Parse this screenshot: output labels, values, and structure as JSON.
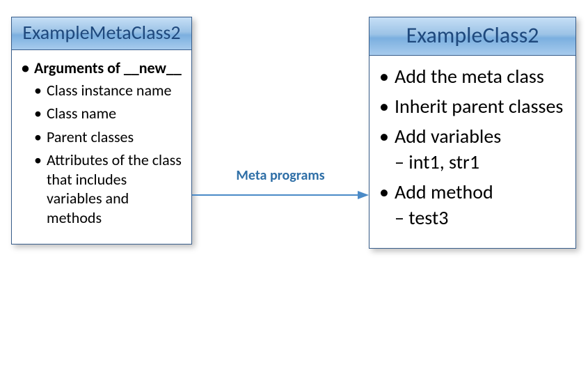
{
  "colors": {
    "header_text": "#1f497d",
    "border": "#385d8a",
    "arrow": "#4a8ac7",
    "arrow_label": "#2f6fa7"
  },
  "arrow": {
    "label": "Meta programs"
  },
  "left": {
    "title": "ExampleMetaClass2",
    "heading": "Arguments of __new__",
    "items": [
      "Class instance name",
      "Class name",
      "Parent classes",
      "Attributes of the class that includes variables and methods"
    ]
  },
  "right": {
    "title": "ExampleClass2",
    "items": [
      {
        "label": "Add the meta class",
        "sub": null
      },
      {
        "label": "Inherit parent classes",
        "sub": null
      },
      {
        "label": "Add variables",
        "sub": "int1, str1"
      },
      {
        "label": "Add method",
        "sub": "test3"
      }
    ]
  }
}
